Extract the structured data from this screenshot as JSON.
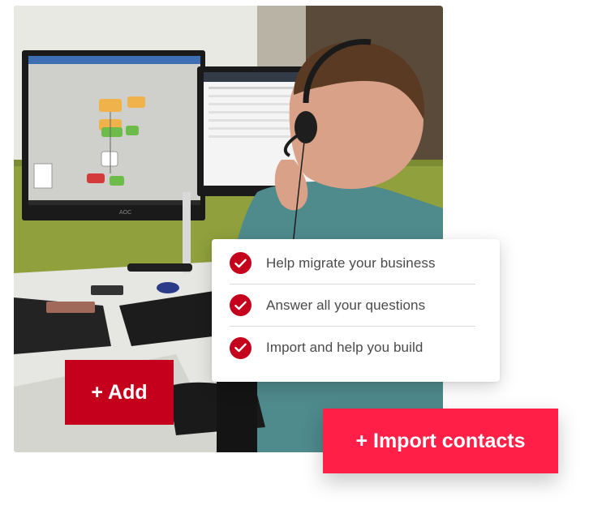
{
  "photo": {
    "monitor_brand": "AOC"
  },
  "checklist": {
    "items": [
      {
        "label": "Help migrate your business",
        "icon": "checkmark-circle-icon"
      },
      {
        "label": "Answer all your questions",
        "icon": "checkmark-circle-icon"
      },
      {
        "label": "Import and help you build",
        "icon": "checkmark-circle-icon"
      }
    ]
  },
  "buttons": {
    "add_label": "+ Add",
    "import_label": "+ Import contacts"
  },
  "colors": {
    "check_red": "#c4001c",
    "add_button": "#c4001c",
    "import_button": "#ff1f47"
  }
}
